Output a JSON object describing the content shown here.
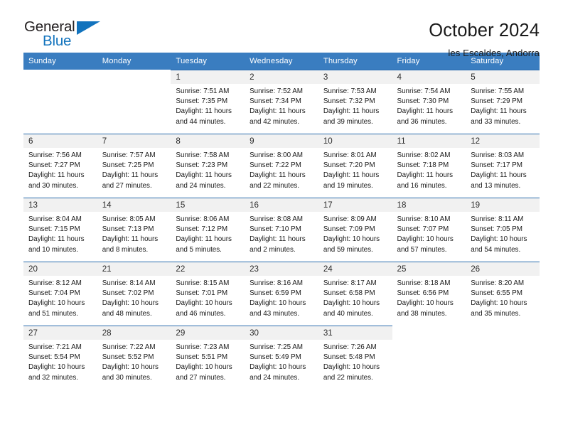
{
  "brand": {
    "name_primary": "General",
    "name_secondary": "Blue",
    "accent_color": "#1273bd"
  },
  "header": {
    "title": "October 2024",
    "subtitle": "les Escaldes, Andorra"
  },
  "theme": {
    "header_row_color": "#3a7dc0",
    "row_divider_color": "#2b6cad",
    "daynum_band_color": "#f1f1f1"
  },
  "weekday_headers": [
    "Sunday",
    "Monday",
    "Tuesday",
    "Wednesday",
    "Thursday",
    "Friday",
    "Saturday"
  ],
  "labels": {
    "sunrise_prefix": "Sunrise:",
    "sunset_prefix": "Sunset:",
    "daylight_prefix": "Daylight:"
  },
  "weeks": [
    [
      {
        "day": "",
        "sunrise": "",
        "sunset": "",
        "daylight_line1": "",
        "daylight_line2": ""
      },
      {
        "day": "",
        "sunrise": "",
        "sunset": "",
        "daylight_line1": "",
        "daylight_line2": ""
      },
      {
        "day": "1",
        "sunrise": "Sunrise: 7:51 AM",
        "sunset": "Sunset: 7:35 PM",
        "daylight_line1": "Daylight: 11 hours",
        "daylight_line2": "and 44 minutes."
      },
      {
        "day": "2",
        "sunrise": "Sunrise: 7:52 AM",
        "sunset": "Sunset: 7:34 PM",
        "daylight_line1": "Daylight: 11 hours",
        "daylight_line2": "and 42 minutes."
      },
      {
        "day": "3",
        "sunrise": "Sunrise: 7:53 AM",
        "sunset": "Sunset: 7:32 PM",
        "daylight_line1": "Daylight: 11 hours",
        "daylight_line2": "and 39 minutes."
      },
      {
        "day": "4",
        "sunrise": "Sunrise: 7:54 AM",
        "sunset": "Sunset: 7:30 PM",
        "daylight_line1": "Daylight: 11 hours",
        "daylight_line2": "and 36 minutes."
      },
      {
        "day": "5",
        "sunrise": "Sunrise: 7:55 AM",
        "sunset": "Sunset: 7:29 PM",
        "daylight_line1": "Daylight: 11 hours",
        "daylight_line2": "and 33 minutes."
      }
    ],
    [
      {
        "day": "6",
        "sunrise": "Sunrise: 7:56 AM",
        "sunset": "Sunset: 7:27 PM",
        "daylight_line1": "Daylight: 11 hours",
        "daylight_line2": "and 30 minutes."
      },
      {
        "day": "7",
        "sunrise": "Sunrise: 7:57 AM",
        "sunset": "Sunset: 7:25 PM",
        "daylight_line1": "Daylight: 11 hours",
        "daylight_line2": "and 27 minutes."
      },
      {
        "day": "8",
        "sunrise": "Sunrise: 7:58 AM",
        "sunset": "Sunset: 7:23 PM",
        "daylight_line1": "Daylight: 11 hours",
        "daylight_line2": "and 24 minutes."
      },
      {
        "day": "9",
        "sunrise": "Sunrise: 8:00 AM",
        "sunset": "Sunset: 7:22 PM",
        "daylight_line1": "Daylight: 11 hours",
        "daylight_line2": "and 22 minutes."
      },
      {
        "day": "10",
        "sunrise": "Sunrise: 8:01 AM",
        "sunset": "Sunset: 7:20 PM",
        "daylight_line1": "Daylight: 11 hours",
        "daylight_line2": "and 19 minutes."
      },
      {
        "day": "11",
        "sunrise": "Sunrise: 8:02 AM",
        "sunset": "Sunset: 7:18 PM",
        "daylight_line1": "Daylight: 11 hours",
        "daylight_line2": "and 16 minutes."
      },
      {
        "day": "12",
        "sunrise": "Sunrise: 8:03 AM",
        "sunset": "Sunset: 7:17 PM",
        "daylight_line1": "Daylight: 11 hours",
        "daylight_line2": "and 13 minutes."
      }
    ],
    [
      {
        "day": "13",
        "sunrise": "Sunrise: 8:04 AM",
        "sunset": "Sunset: 7:15 PM",
        "daylight_line1": "Daylight: 11 hours",
        "daylight_line2": "and 10 minutes."
      },
      {
        "day": "14",
        "sunrise": "Sunrise: 8:05 AM",
        "sunset": "Sunset: 7:13 PM",
        "daylight_line1": "Daylight: 11 hours",
        "daylight_line2": "and 8 minutes."
      },
      {
        "day": "15",
        "sunrise": "Sunrise: 8:06 AM",
        "sunset": "Sunset: 7:12 PM",
        "daylight_line1": "Daylight: 11 hours",
        "daylight_line2": "and 5 minutes."
      },
      {
        "day": "16",
        "sunrise": "Sunrise: 8:08 AM",
        "sunset": "Sunset: 7:10 PM",
        "daylight_line1": "Daylight: 11 hours",
        "daylight_line2": "and 2 minutes."
      },
      {
        "day": "17",
        "sunrise": "Sunrise: 8:09 AM",
        "sunset": "Sunset: 7:09 PM",
        "daylight_line1": "Daylight: 10 hours",
        "daylight_line2": "and 59 minutes."
      },
      {
        "day": "18",
        "sunrise": "Sunrise: 8:10 AM",
        "sunset": "Sunset: 7:07 PM",
        "daylight_line1": "Daylight: 10 hours",
        "daylight_line2": "and 57 minutes."
      },
      {
        "day": "19",
        "sunrise": "Sunrise: 8:11 AM",
        "sunset": "Sunset: 7:05 PM",
        "daylight_line1": "Daylight: 10 hours",
        "daylight_line2": "and 54 minutes."
      }
    ],
    [
      {
        "day": "20",
        "sunrise": "Sunrise: 8:12 AM",
        "sunset": "Sunset: 7:04 PM",
        "daylight_line1": "Daylight: 10 hours",
        "daylight_line2": "and 51 minutes."
      },
      {
        "day": "21",
        "sunrise": "Sunrise: 8:14 AM",
        "sunset": "Sunset: 7:02 PM",
        "daylight_line1": "Daylight: 10 hours",
        "daylight_line2": "and 48 minutes."
      },
      {
        "day": "22",
        "sunrise": "Sunrise: 8:15 AM",
        "sunset": "Sunset: 7:01 PM",
        "daylight_line1": "Daylight: 10 hours",
        "daylight_line2": "and 46 minutes."
      },
      {
        "day": "23",
        "sunrise": "Sunrise: 8:16 AM",
        "sunset": "Sunset: 6:59 PM",
        "daylight_line1": "Daylight: 10 hours",
        "daylight_line2": "and 43 minutes."
      },
      {
        "day": "24",
        "sunrise": "Sunrise: 8:17 AM",
        "sunset": "Sunset: 6:58 PM",
        "daylight_line1": "Daylight: 10 hours",
        "daylight_line2": "and 40 minutes."
      },
      {
        "day": "25",
        "sunrise": "Sunrise: 8:18 AM",
        "sunset": "Sunset: 6:56 PM",
        "daylight_line1": "Daylight: 10 hours",
        "daylight_line2": "and 38 minutes."
      },
      {
        "day": "26",
        "sunrise": "Sunrise: 8:20 AM",
        "sunset": "Sunset: 6:55 PM",
        "daylight_line1": "Daylight: 10 hours",
        "daylight_line2": "and 35 minutes."
      }
    ],
    [
      {
        "day": "27",
        "sunrise": "Sunrise: 7:21 AM",
        "sunset": "Sunset: 5:54 PM",
        "daylight_line1": "Daylight: 10 hours",
        "daylight_line2": "and 32 minutes."
      },
      {
        "day": "28",
        "sunrise": "Sunrise: 7:22 AM",
        "sunset": "Sunset: 5:52 PM",
        "daylight_line1": "Daylight: 10 hours",
        "daylight_line2": "and 30 minutes."
      },
      {
        "day": "29",
        "sunrise": "Sunrise: 7:23 AM",
        "sunset": "Sunset: 5:51 PM",
        "daylight_line1": "Daylight: 10 hours",
        "daylight_line2": "and 27 minutes."
      },
      {
        "day": "30",
        "sunrise": "Sunrise: 7:25 AM",
        "sunset": "Sunset: 5:49 PM",
        "daylight_line1": "Daylight: 10 hours",
        "daylight_line2": "and 24 minutes."
      },
      {
        "day": "31",
        "sunrise": "Sunrise: 7:26 AM",
        "sunset": "Sunset: 5:48 PM",
        "daylight_line1": "Daylight: 10 hours",
        "daylight_line2": "and 22 minutes."
      },
      {
        "day": "",
        "sunrise": "",
        "sunset": "",
        "daylight_line1": "",
        "daylight_line2": ""
      },
      {
        "day": "",
        "sunrise": "",
        "sunset": "",
        "daylight_line1": "",
        "daylight_line2": ""
      }
    ]
  ]
}
